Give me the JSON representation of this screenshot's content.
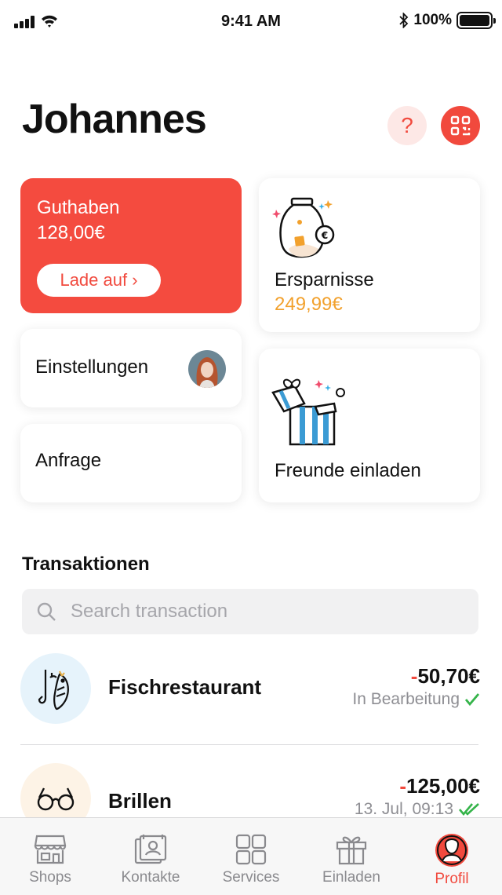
{
  "status_bar": {
    "time": "9:41 AM",
    "battery": "100%"
  },
  "header": {
    "title": "Johannes",
    "help_icon": "question-icon",
    "qr_icon": "qr-code-icon"
  },
  "colors": {
    "accent": "#f14a3e",
    "savings_amount": "#f2a12d",
    "check": "#35b44a"
  },
  "balance_card": {
    "label": "Guthaben",
    "amount": "128,00€",
    "button": "Lade auf ›"
  },
  "savings_card": {
    "label": "Ersparnisse",
    "amount": "249,99€",
    "icon": "savings-jar-icon"
  },
  "settings_card": {
    "label": "Einstellungen"
  },
  "request_card": {
    "label": "Anfrage"
  },
  "invite_card": {
    "label": "Freunde einladen",
    "icon": "gift-box-icon"
  },
  "transactions": {
    "title": "Transaktionen",
    "search_placeholder": "Search transaction",
    "items": [
      {
        "name": "Fischrestaurant",
        "sign": "-",
        "amount": "50,70€",
        "status": "In Bearbeitung",
        "icon": "fish-hook-icon"
      },
      {
        "name": "Brillen",
        "sign": "-",
        "amount": "125,00€",
        "status": "13. Jul, 09:13",
        "icon": "glasses-icon"
      }
    ]
  },
  "tabbar": {
    "items": [
      {
        "label": "Shops",
        "icon": "shop-icon"
      },
      {
        "label": "Kontakte",
        "icon": "contacts-icon"
      },
      {
        "label": "Services",
        "icon": "services-grid-icon"
      },
      {
        "label": "Einladen",
        "icon": "gift-icon"
      },
      {
        "label": "Profil",
        "icon": "profile-icon",
        "active": true
      }
    ]
  }
}
